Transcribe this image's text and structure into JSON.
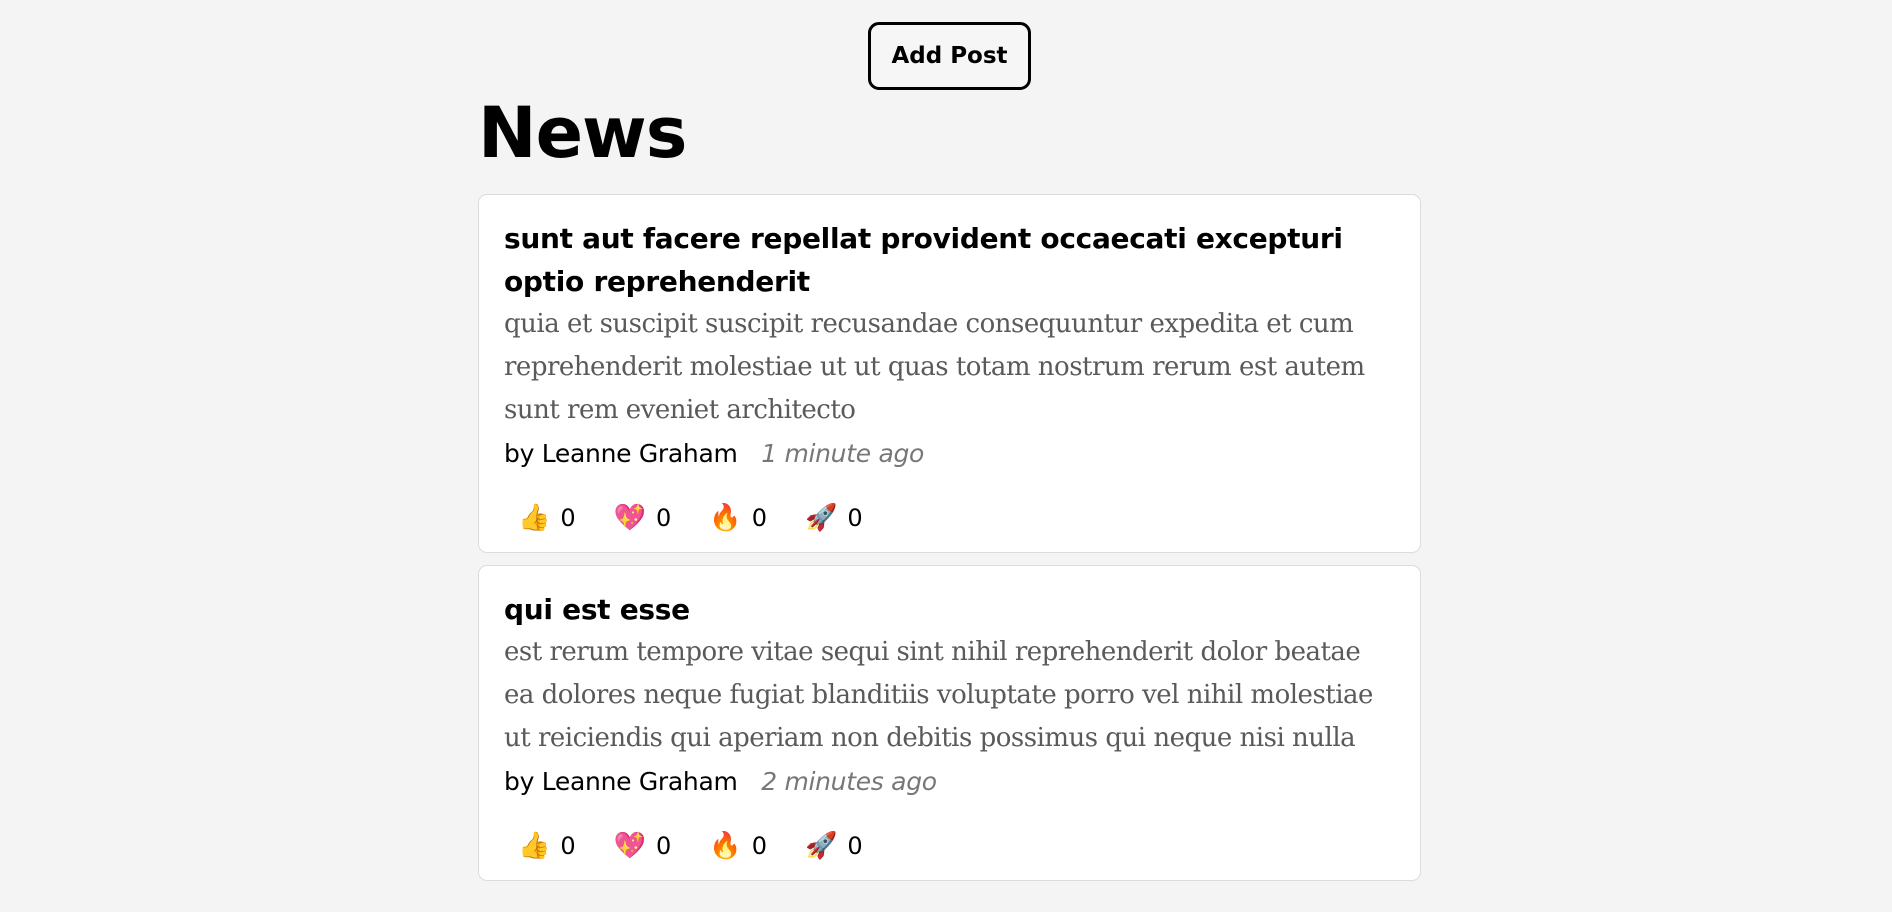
{
  "toolbar": {
    "add_post_label": "Add Post"
  },
  "header": {
    "title": "News"
  },
  "posts": [
    {
      "title": "sunt aut facere repellat provident occaecati excepturi optio reprehenderit",
      "body": "quia et suscipit suscipit recusandae consequuntur expedita et cum reprehenderit molestiae ut ut quas totam nostrum rerum est autem sunt rem eveniet architecto",
      "by": "by",
      "author": "Leanne Graham",
      "time": "1 minute ago",
      "reactions": [
        {
          "icon": "thumbs-up-icon",
          "glyph": "👍",
          "count": "0"
        },
        {
          "icon": "sparkling-heart-icon",
          "glyph": "💖",
          "count": "0"
        },
        {
          "icon": "fire-icon",
          "glyph": "🔥",
          "count": "0"
        },
        {
          "icon": "rocket-icon",
          "glyph": "🚀",
          "count": "0"
        }
      ]
    },
    {
      "title": "qui est esse",
      "body": "est rerum tempore vitae sequi sint nihil reprehenderit dolor beatae ea dolores neque fugiat blanditiis voluptate porro vel nihil molestiae ut reiciendis qui aperiam non debitis possimus qui neque nisi nulla",
      "by": "by",
      "author": "Leanne Graham",
      "time": "2 minutes ago",
      "reactions": [
        {
          "icon": "thumbs-up-icon",
          "glyph": "👍",
          "count": "0"
        },
        {
          "icon": "sparkling-heart-icon",
          "glyph": "💖",
          "count": "0"
        },
        {
          "icon": "fire-icon",
          "glyph": "🔥",
          "count": "0"
        },
        {
          "icon": "rocket-icon",
          "glyph": "🚀",
          "count": "0"
        }
      ]
    }
  ]
}
